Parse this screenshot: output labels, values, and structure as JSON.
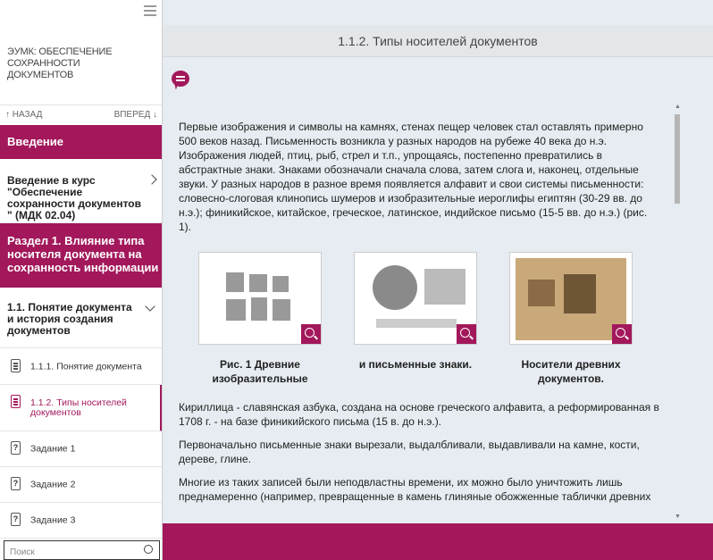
{
  "sidebar": {
    "course_title": "ЭУМК: ОБЕСПЕЧЕНИЕ СОХРАННОСТИ ДОКУМЕНТОВ",
    "nav_back": "↑ НАЗАД",
    "nav_forward": "ВПЕРЕД ↓",
    "section_intro": "Введение",
    "subsection_intro": "Введение в курс \"Обеспечение сохранности документов \" (МДК 02.04)",
    "section_part1": "Раздел 1. Влияние типа носителя документа на сохранность информации",
    "subsection_concept": "1.1. Понятие документа и история создания документов",
    "items": [
      {
        "label": "1.1.1. Понятие документа",
        "icon": "document-icon"
      },
      {
        "label": "1.1.2. Типы носителей документов",
        "icon": "document-icon",
        "active": true
      },
      {
        "label": "Задание 1",
        "icon": "question-icon"
      },
      {
        "label": "Задание 2",
        "icon": "question-icon"
      },
      {
        "label": "Задание 3",
        "icon": "question-icon"
      }
    ],
    "search_placeholder": "Поиск"
  },
  "main": {
    "page_title": "1.1.2. Типы носителей документов",
    "paragraph1": "Первые изображения и символы на камнях, стенах пещер человек стал оставлять примерно 500 веков назад. Письменность возникла у разных народов на рубеже 40 века до н.э. Изображения людей, птиц, рыб, стрел и т.п., упрощаясь, постепенно превратились в абстрактные знаки. Знаками обозначали сначала слова, затем слога и, наконец, отдельные звуки. У разных народов в разное время появляется алфавит и свои системы письменности: словесно-слоговая клинопись шумеров и изобразительные иероглифы египтян (30-29 вв. до н.э.); финикийское, китайское, греческое, латинское, индийское письмо (15-5 вв. до н.э.) (рис. 1).",
    "figures": [
      {
        "caption": "Рис. 1 Древние изобразительные"
      },
      {
        "caption": "и письменные знаки."
      },
      {
        "caption": "Носители древних документов."
      }
    ],
    "paragraph2": "Кириллица - славянская азбука, создана на основе греческого алфавита, а реформированная в 1708 г. - на базе финикийского письма (15 в. до н.э.).",
    "paragraph3": "Первоначально письменные знаки вырезали, выдалбливали, выдавливали на камне, кости, дереве, глине.",
    "paragraph4": "Многие из таких записей были неподвластны времени, их можно было уничтожить лишь преднамеренно (например, превращенные в камень глиняные обожженные таблички древних"
  },
  "colors": {
    "accent": "#a2185b",
    "background": "#e6ecf1"
  }
}
